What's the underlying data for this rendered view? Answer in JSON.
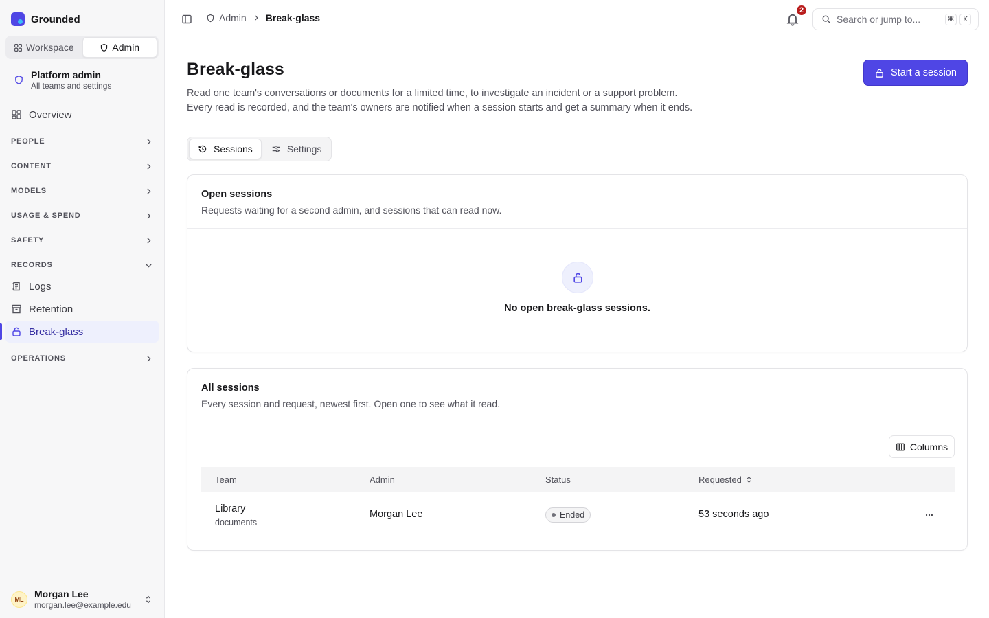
{
  "app": {
    "name": "Grounded"
  },
  "switcher": {
    "workspace": "Workspace",
    "admin": "Admin"
  },
  "scope": {
    "title": "Platform admin",
    "subtitle": "All teams and settings"
  },
  "nav": {
    "overview": "Overview",
    "groups": [
      "PEOPLE",
      "CONTENT",
      "MODELS",
      "USAGE & SPEND",
      "SAFETY",
      "RECORDS",
      "OPERATIONS"
    ],
    "records_items": [
      "Logs",
      "Retention",
      "Break-glass"
    ]
  },
  "user": {
    "initials": "ML",
    "name": "Morgan Lee",
    "email": "morgan.lee@example.edu"
  },
  "breadcrumb": {
    "parent": "Admin",
    "current": "Break-glass"
  },
  "notifications": {
    "count": "2"
  },
  "search": {
    "placeholder": "Search or jump to...",
    "kbd1": "⌘",
    "kbd2": "K"
  },
  "page": {
    "title": "Break-glass",
    "desc1": "Read one team's conversations or documents for a limited time, to investigate an incident or a support problem.",
    "desc2": "Every read is recorded, and the team's owners are notified when a session starts and get a summary when it ends.",
    "primary_action": "Start a session"
  },
  "tabs": {
    "sessions": "Sessions",
    "settings": "Settings"
  },
  "open_sessions": {
    "title": "Open sessions",
    "subtitle": "Requests waiting for a second admin, and sessions that can read now.",
    "empty": "No open break-glass sessions."
  },
  "all_sessions": {
    "title": "All sessions",
    "subtitle": "Every session and request, newest first. Open one to see what it read.",
    "columns_button": "Columns",
    "headers": {
      "team": "Team",
      "admin": "Admin",
      "status": "Status",
      "requested": "Requested"
    },
    "rows": [
      {
        "team": "Library",
        "scope": "documents",
        "admin": "Morgan Lee",
        "status": "Ended",
        "requested": "53 seconds ago"
      }
    ]
  },
  "colors": {
    "accent": "#4f46e5",
    "badge_red": "#b91c1c"
  }
}
